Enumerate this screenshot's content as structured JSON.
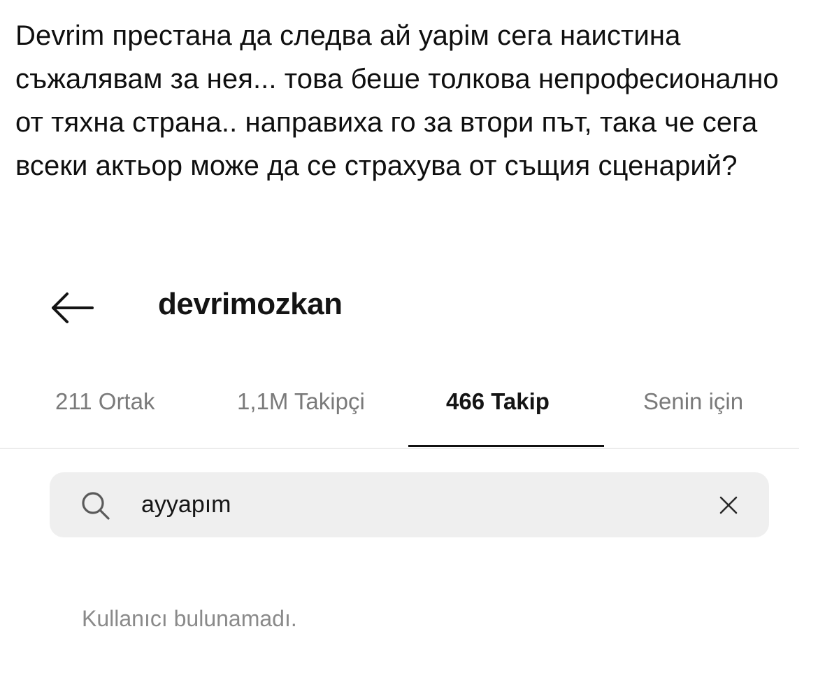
{
  "post": {
    "text": "Devrim престана да следва ай уарім сега наистина съжалявам за нея... това беше толкова непрофесионално от тяхна страна.. направиха го за втори път, така че сега всеки актьор може да се страхува от същия сценарий?"
  },
  "header": {
    "back_icon": "arrow-left-icon",
    "username": "devrimozkan"
  },
  "tabs": [
    {
      "label": "211 Ortak",
      "active": false
    },
    {
      "label": "1,1M Takipçi",
      "active": false
    },
    {
      "label": "466 Takip",
      "active": true
    },
    {
      "label": "Senin için",
      "active": false
    }
  ],
  "search": {
    "icon": "search-icon",
    "value": "ayyapım",
    "clear_icon": "close-icon"
  },
  "results": {
    "empty_message": "Kullanıcı bulunamadı."
  },
  "colors": {
    "active_tab": "#141414",
    "inactive_tab": "#7a7a7a",
    "search_background": "#efefef",
    "divider": "#d9d9d9"
  }
}
